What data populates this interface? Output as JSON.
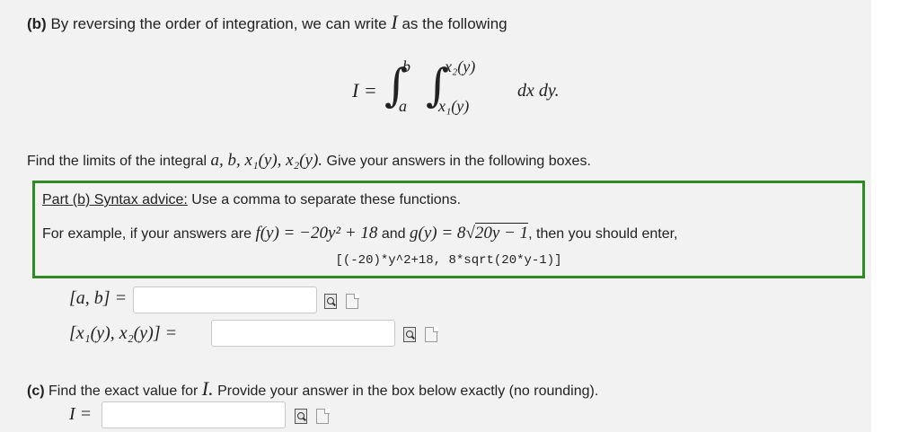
{
  "part_b": {
    "tag": "(b)",
    "intro": "By reversing the order of integration, we can write",
    "var": "I",
    "intro_tail": "as the following",
    "integral": {
      "lhs": "I =",
      "outer_upper": "b",
      "outer_lower": "a",
      "inner_upper": "x₂(y)",
      "inner_lower": "x₁(y)",
      "integrand": "dx dy."
    },
    "find_text": "Find the limits of the integral",
    "find_vars": "a, b, x₁(y), x₂(y).",
    "find_tail": "Give your answers in the following boxes."
  },
  "advice": {
    "link": "Part (b) Syntax advice:",
    "line1": "Use a comma to separate these functions.",
    "line2_a": "For example, if your answers are",
    "f_expr": "f(y) = −20y² + 18",
    "line2_and": "and",
    "g_expr_lhs": "g(y) = 8",
    "g_sqrt": "20y − 1",
    "line2_tail": ", then you should enter,",
    "code": "[(-20)*y^2+18, 8*sqrt(20*y-1)]"
  },
  "answers": {
    "ab_label": "[a, b] =",
    "ab_value": "",
    "x_label": "[x₁(y), x₂(y)] =",
    "x_value": "",
    "I_label": "I =",
    "I_value": ""
  },
  "part_c": {
    "tag": "(c)",
    "text": "Find the exact value for",
    "var": "I.",
    "tail": "Provide your answer in the box below exactly (no rounding)."
  },
  "icons": {
    "preview": "preview-icon",
    "format": "format-help-icon"
  }
}
